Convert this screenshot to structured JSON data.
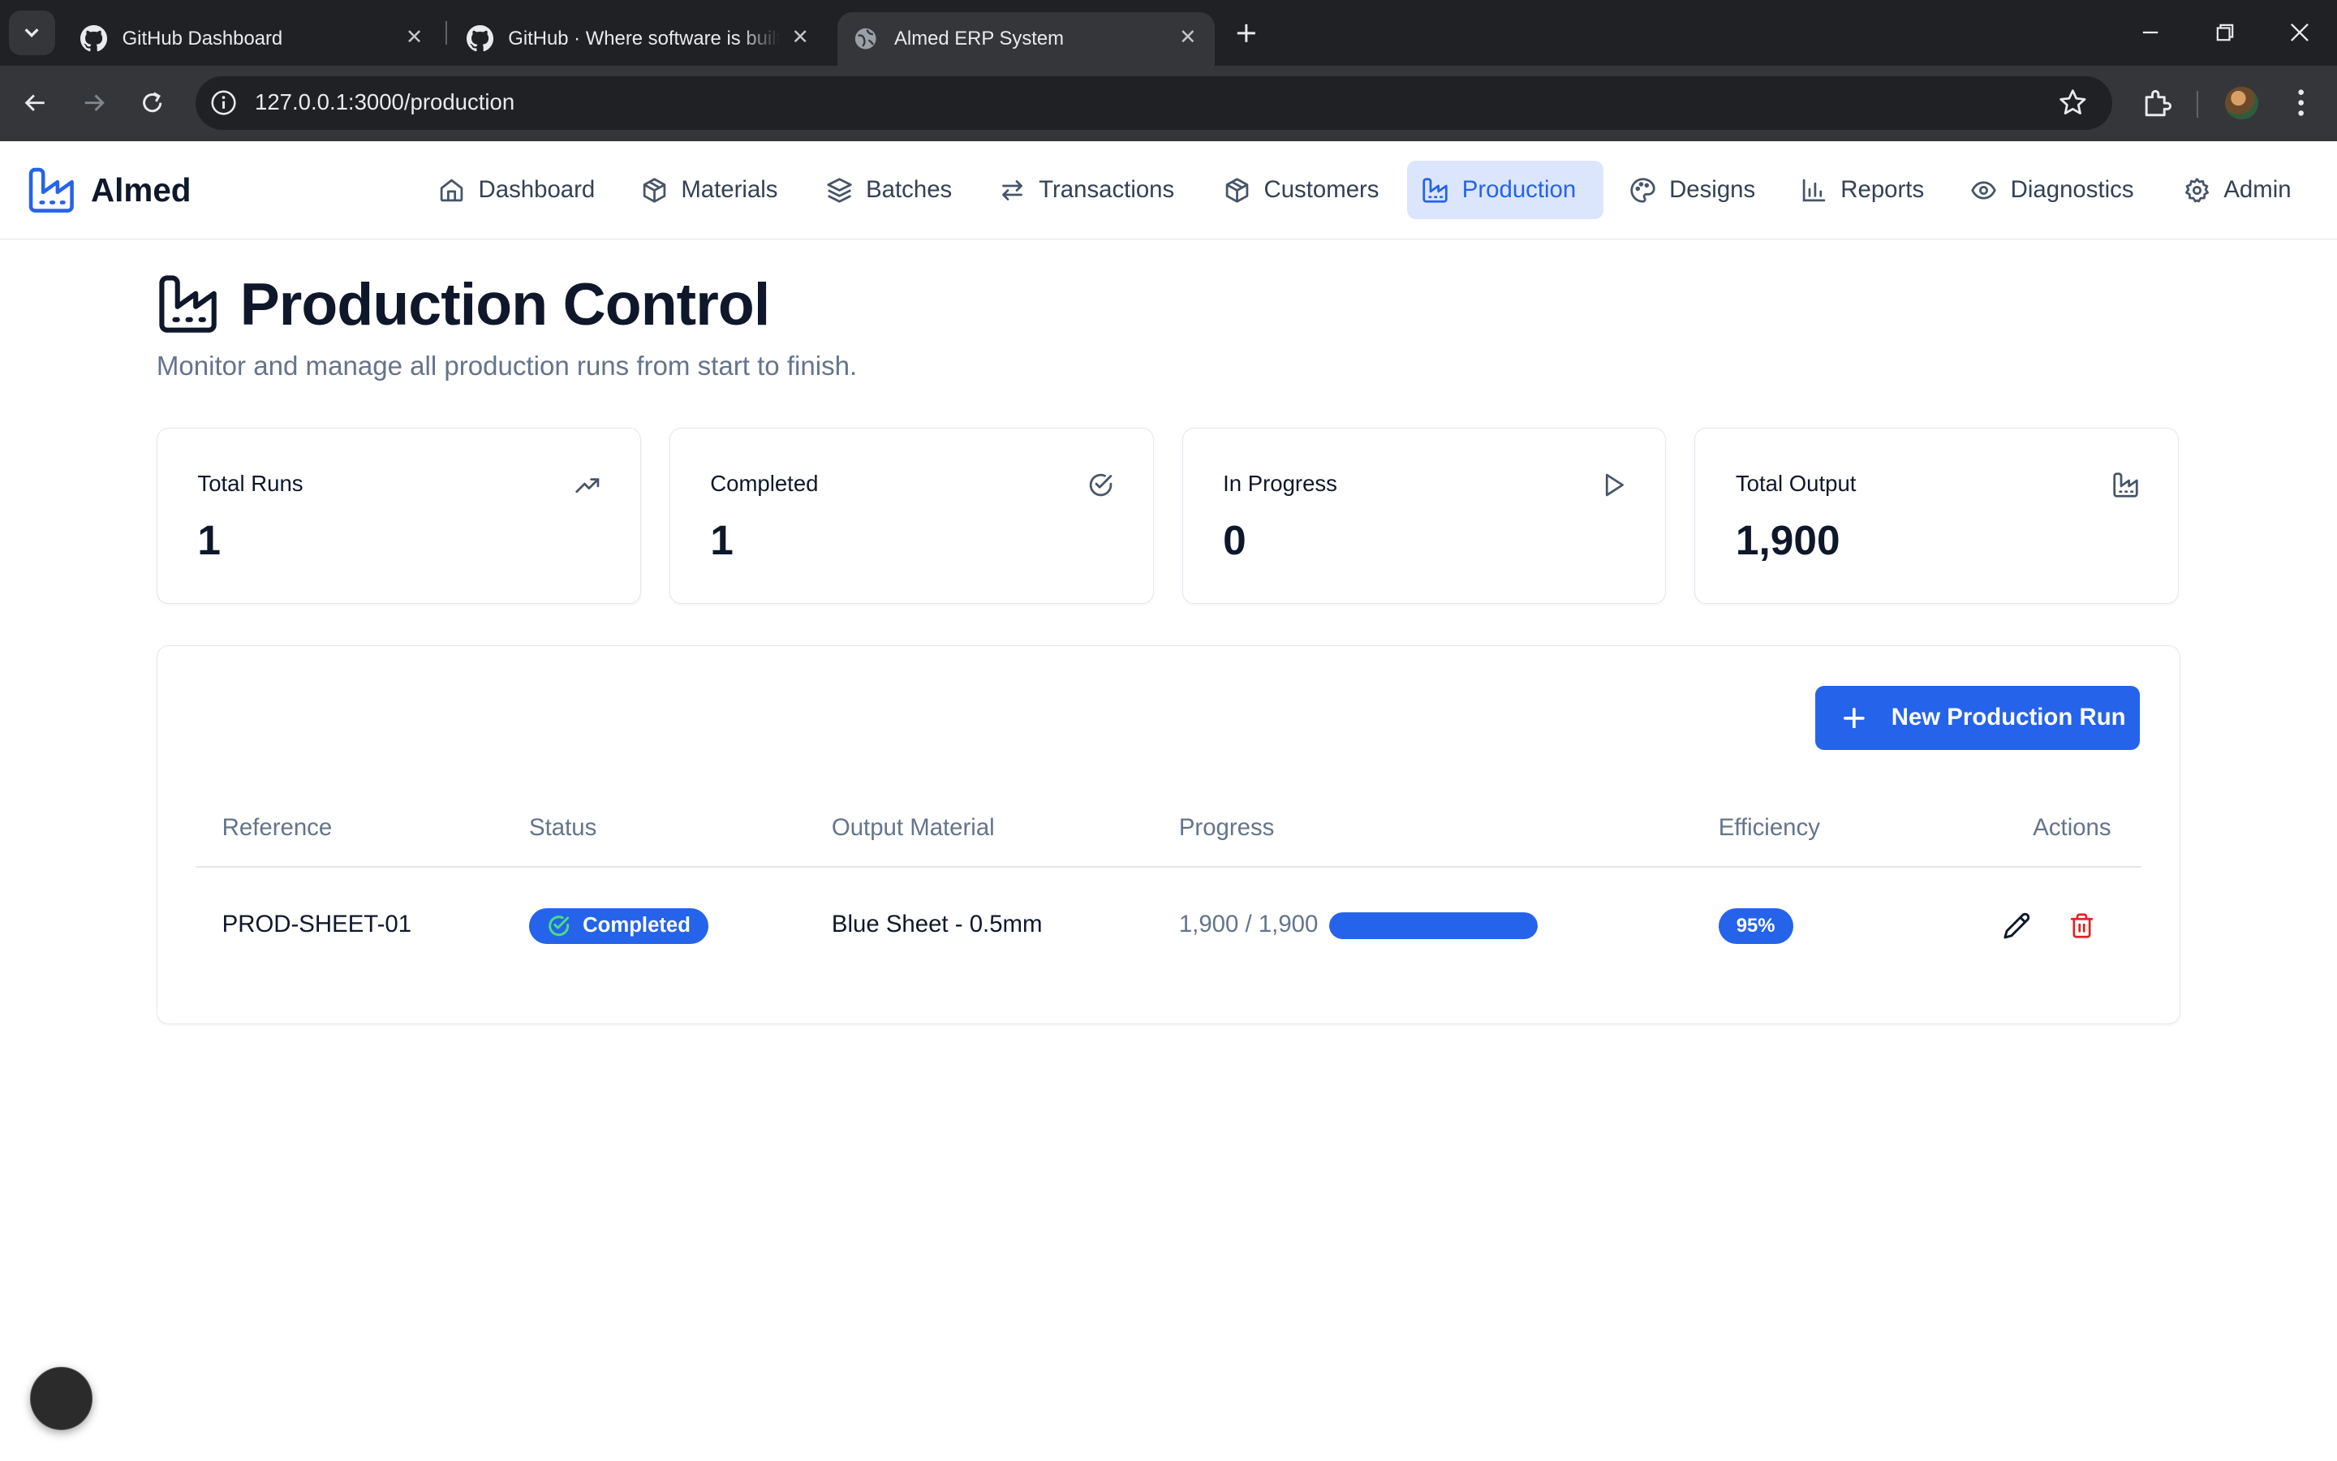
{
  "browser": {
    "tabs": [
      {
        "title": "GitHub Dashboard",
        "favicon": "github-icon",
        "active": false
      },
      {
        "title": "GitHub · Where software is built",
        "favicon": "github-icon",
        "active": false
      },
      {
        "title": "Almed ERP System",
        "favicon": "globe-icon",
        "active": true
      }
    ],
    "url": "127.0.0.1:3000/production"
  },
  "app": {
    "brand": "Almed",
    "nav": [
      {
        "label": "Dashboard",
        "icon": "home-icon",
        "active": false
      },
      {
        "label": "Materials",
        "icon": "box-icon",
        "active": false
      },
      {
        "label": "Batches",
        "icon": "layers-icon",
        "active": false
      },
      {
        "label": "Transactions",
        "icon": "arrows-icon",
        "active": false
      },
      {
        "label": "Customers",
        "icon": "box-icon",
        "active": false
      },
      {
        "label": "Production",
        "icon": "factory-icon",
        "active": true
      },
      {
        "label": "Designs",
        "icon": "palette-icon",
        "active": false
      },
      {
        "label": "Reports",
        "icon": "bar-chart-icon",
        "active": false
      },
      {
        "label": "Diagnostics",
        "icon": "eye-icon",
        "active": false
      },
      {
        "label": "Admin",
        "icon": "gear-icon",
        "active": false
      }
    ]
  },
  "page": {
    "title": "Production Control",
    "subtitle": "Monitor and manage all production runs from start to finish."
  },
  "stats": [
    {
      "label": "Total Runs",
      "value": "1",
      "icon": "trending-up-icon"
    },
    {
      "label": "Completed",
      "value": "1",
      "icon": "check-circle-icon"
    },
    {
      "label": "In Progress",
      "value": "0",
      "icon": "play-icon"
    },
    {
      "label": "Total Output",
      "value": "1,900",
      "icon": "factory-icon"
    }
  ],
  "table": {
    "new_button_label": "New Production Run",
    "headers": [
      "Reference",
      "Status",
      "Output Material",
      "Progress",
      "Efficiency",
      "Actions"
    ],
    "rows": [
      {
        "reference": "PROD-SHEET-01",
        "status": "Completed",
        "output_material": "Blue Sheet - 0.5mm",
        "progress_text": "1,900 / 1,900",
        "progress_fraction": 1.0,
        "efficiency": "95%"
      }
    ]
  },
  "colors": {
    "accent": "#2563eb",
    "accent_light": "#dbe6fd",
    "danger": "#dc2626",
    "muted_text": "#64748b"
  }
}
